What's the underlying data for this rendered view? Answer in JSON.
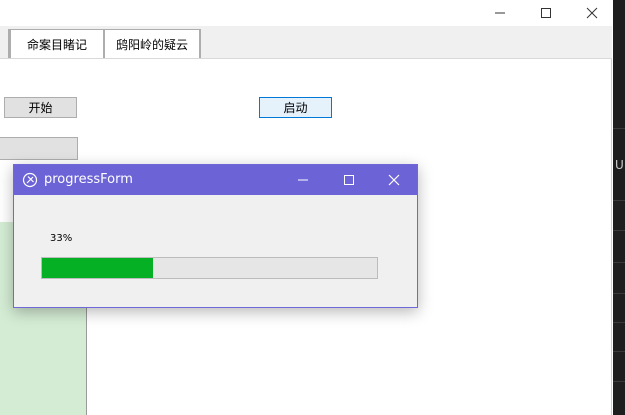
{
  "main_window": {
    "controls": {
      "minimize": "minimize-icon",
      "maximize": "maximize-icon",
      "close": "close-icon"
    },
    "tabs": [
      {
        "label": "命案目睹记"
      },
      {
        "label": "鸱阳岭的疑云"
      }
    ],
    "buttons": {
      "start_label": "开始",
      "launch_label": "启动"
    }
  },
  "background_window": {
    "visible_letter": "U"
  },
  "progress_dialog": {
    "title": "progressForm",
    "percent_text": "33%",
    "progress_fraction": 0.33,
    "fill_color": "#06b025",
    "titlebar_color": "#6b63d6"
  }
}
